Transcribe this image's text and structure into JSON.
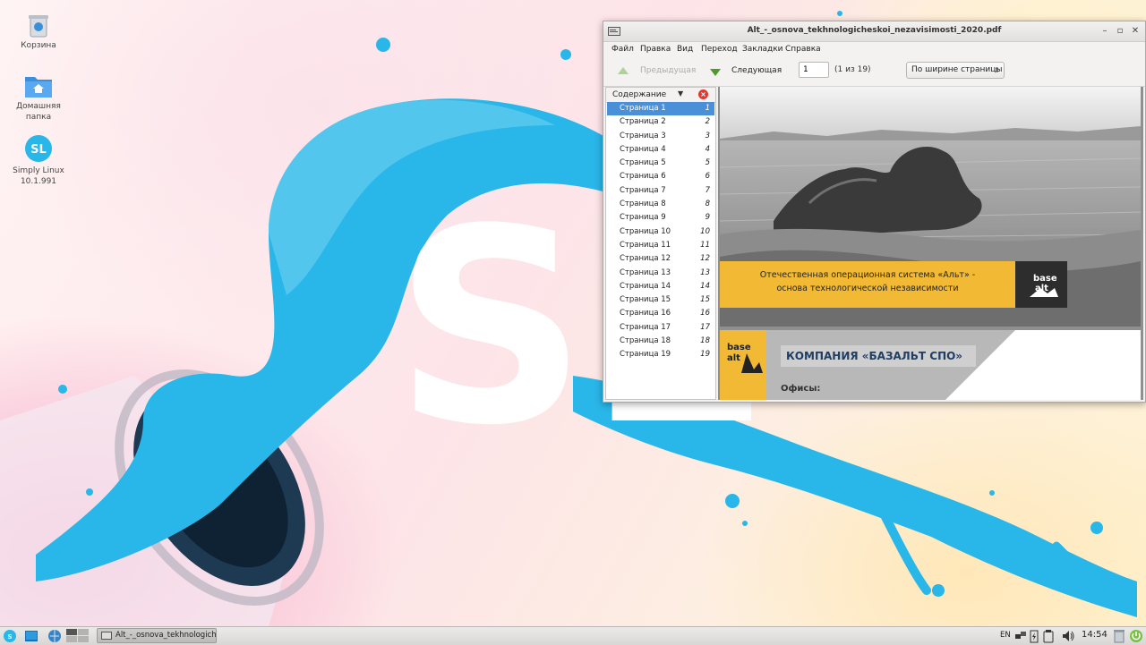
{
  "desktop": {
    "icons": [
      {
        "label": "Корзина"
      },
      {
        "label": "Домашняя\nпапка",
        "line1": "Домашняя",
        "line2": "папка"
      },
      {
        "label": "Simply Linux\n10.1.991",
        "line1": "Simply Linux",
        "line2": "10.1.991",
        "badge": "SL"
      }
    ],
    "wallpaper_logo": "SL",
    "colors": {
      "splash": "#29b6e8",
      "splash_dark": "#0e8fc8"
    }
  },
  "window": {
    "title": "Alt_-_osnova_tekhnologicheskoi_nezavisimosti_2020.pdf",
    "menu": [
      "Файл",
      "Правка",
      "Вид",
      "Переход",
      "Закладки",
      "Справка"
    ],
    "toolbar": {
      "prev_label": "Предыдущая",
      "next_label": "Следующая",
      "page_value": "1",
      "page_count": "(1 из 19)",
      "zoom": "По ширине страницы"
    },
    "sidebar": {
      "header": "Содержание",
      "items": [
        {
          "title": "Страница 1",
          "page": "1"
        },
        {
          "title": "Страница 2",
          "page": "2"
        },
        {
          "title": "Страница 3",
          "page": "3"
        },
        {
          "title": "Страница 4",
          "page": "4"
        },
        {
          "title": "Страница 5",
          "page": "5"
        },
        {
          "title": "Страница 6",
          "page": "6"
        },
        {
          "title": "Страница 7",
          "page": "7"
        },
        {
          "title": "Страница 8",
          "page": "8"
        },
        {
          "title": "Страница 9",
          "page": "9"
        },
        {
          "title": "Страница 10",
          "page": "10"
        },
        {
          "title": "Страница 11",
          "page": "11"
        },
        {
          "title": "Страница 12",
          "page": "12"
        },
        {
          "title": "Страница 13",
          "page": "13"
        },
        {
          "title": "Страница 14",
          "page": "14"
        },
        {
          "title": "Страница 15",
          "page": "15"
        },
        {
          "title": "Страница 16",
          "page": "16"
        },
        {
          "title": "Страница 17",
          "page": "17"
        },
        {
          "title": "Страница 18",
          "page": "18"
        },
        {
          "title": "Страница 19",
          "page": "19"
        }
      ]
    },
    "document": {
      "banner_line1": "Отечественная операционная система «Альт» -",
      "banner_line2": "основа технологической независимости",
      "logo_top": "base",
      "logo_bottom": "alt",
      "page2_title": "КОМПАНИЯ «БАЗАЛЬТ СПО»",
      "page2_offices": "Офисы:"
    }
  },
  "taskbar": {
    "task_label": "Alt_-_osnova_tekhnologich...",
    "layout": "EN",
    "clock": "14:54"
  }
}
